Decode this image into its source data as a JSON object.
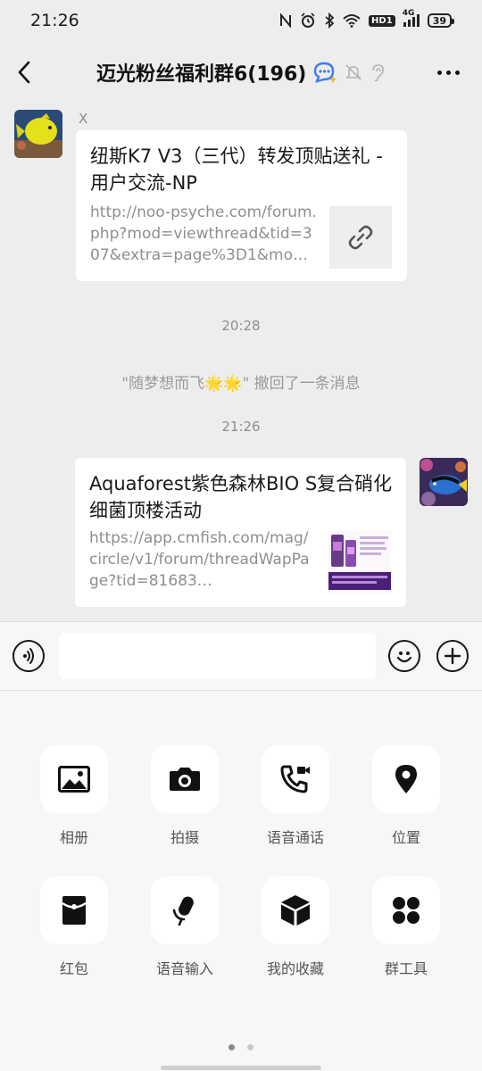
{
  "status_bar": {
    "time": "21:26",
    "network": "4G",
    "hd": "HD1",
    "battery": "39"
  },
  "header": {
    "title": "迈光粉丝福利群6(196)",
    "icons": [
      "back-icon",
      "chat-ai-icon",
      "mute-bell-icon",
      "ear-icon",
      "more-icon"
    ]
  },
  "messages": [
    {
      "type": "link",
      "side": "left",
      "sender": "X",
      "title": "纽斯K7 V3（三代）转发顶贴送礼 - 用户交流-NP",
      "url": "http://noo-psyche.com/forum.php?mod=viewthread&tid=307&extra=page%3D1&mo…",
      "thumb_icon": "link-icon"
    },
    {
      "type": "time",
      "text": "20:28"
    },
    {
      "type": "system",
      "text": "\"随梦想而飞🌟🌟\" 撤回了一条消息"
    },
    {
      "type": "time",
      "text": "21:26"
    },
    {
      "type": "link",
      "side": "right",
      "title": "Aquaforest紫色森林BIO S复合硝化细菌顶楼活动",
      "url": "https://app.cmfish.com/mag/circle/v1/forum/threadWapPage?tid=81683…",
      "thumb_icon": "product-image"
    }
  ],
  "input_bar": {
    "icons": [
      "voice-icon",
      "emoji-icon",
      "plus-icon"
    ],
    "placeholder": ""
  },
  "tools": [
    {
      "label": "相册",
      "icon": "album-icon"
    },
    {
      "label": "拍摄",
      "icon": "camera-icon"
    },
    {
      "label": "语音通话",
      "icon": "voice-call-icon"
    },
    {
      "label": "位置",
      "icon": "location-icon"
    },
    {
      "label": "红包",
      "icon": "red-packet-icon"
    },
    {
      "label": "语音输入",
      "icon": "voice-input-icon"
    },
    {
      "label": "我的收藏",
      "icon": "favorites-icon"
    },
    {
      "label": "群工具",
      "icon": "group-tools-icon"
    }
  ],
  "pager": {
    "pages": 2,
    "current": 1
  }
}
